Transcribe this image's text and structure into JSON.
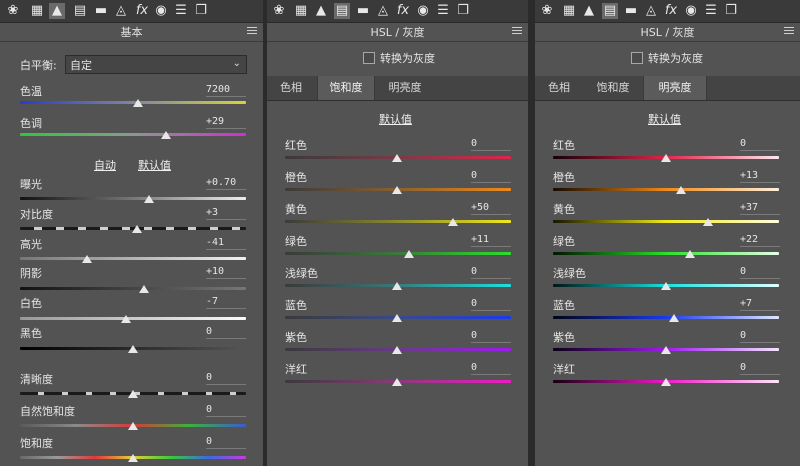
{
  "colors": {
    "panel_bg": "#535353",
    "toolbar_bg": "#3a3a3a",
    "tabbar_bg": "#444444",
    "active_tab_bg": "#5b5b5b",
    "text": "#e6e6e6"
  },
  "toolbar_icons": [
    "aperture-icon",
    "histogram-grid-icon",
    "mountain-icon",
    "split-tone-icon",
    "detail-icon",
    "lens-icon",
    "fx-icon",
    "camera-icon",
    "sliders-icon",
    "presets-icon"
  ],
  "basic": {
    "title": "基本",
    "white_balance": {
      "label": "白平衡:",
      "value": "自定"
    },
    "temp": {
      "label": "色温",
      "value": "7200"
    },
    "tint": {
      "label": "色调",
      "value": "+29"
    },
    "auto_label": "自动",
    "default_label": "默认值",
    "exposure": {
      "label": "曝光",
      "value": "+0.70"
    },
    "contrast": {
      "label": "对比度",
      "value": "+3"
    },
    "highlights": {
      "label": "高光",
      "value": "-41"
    },
    "shadows": {
      "label": "阴影",
      "value": "+10"
    },
    "whites": {
      "label": "白色",
      "value": "-7"
    },
    "blacks": {
      "label": "黑色",
      "value": "0"
    },
    "clarity": {
      "label": "清晰度",
      "value": "0"
    },
    "vibrance": {
      "label": "自然饱和度",
      "value": "0"
    },
    "saturation": {
      "label": "饱和度",
      "value": "0"
    }
  },
  "hsl_sat": {
    "title": "HSL / 灰度",
    "convert_label": "转换为灰度",
    "tabs": [
      "色相",
      "饱和度",
      "明亮度"
    ],
    "default_label": "默认值",
    "rows": [
      {
        "label": "红色",
        "value": "0"
      },
      {
        "label": "橙色",
        "value": "0"
      },
      {
        "label": "黄色",
        "value": "+50"
      },
      {
        "label": "绿色",
        "value": "+11"
      },
      {
        "label": "浅绿色",
        "value": "0"
      },
      {
        "label": "蓝色",
        "value": "0"
      },
      {
        "label": "紫色",
        "value": "0"
      },
      {
        "label": "洋红",
        "value": "0"
      }
    ]
  },
  "hsl_lum": {
    "title": "HSL / 灰度",
    "convert_label": "转换为灰度",
    "tabs": [
      "色相",
      "饱和度",
      "明亮度"
    ],
    "default_label": "默认值",
    "rows": [
      {
        "label": "红色",
        "value": "0"
      },
      {
        "label": "橙色",
        "value": "+13"
      },
      {
        "label": "黄色",
        "value": "+37"
      },
      {
        "label": "绿色",
        "value": "+22"
      },
      {
        "label": "浅绿色",
        "value": "0"
      },
      {
        "label": "蓝色",
        "value": "+7"
      },
      {
        "label": "紫色",
        "value": "0"
      },
      {
        "label": "洋红",
        "value": "0"
      }
    ]
  }
}
